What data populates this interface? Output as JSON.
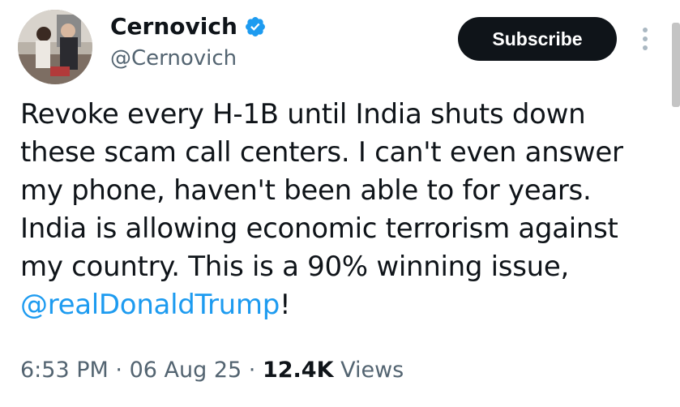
{
  "author": {
    "display_name": "Cernovich",
    "handle": "@Cernovich",
    "verified": true
  },
  "actions": {
    "subscribe_label": "Subscribe"
  },
  "tweet": {
    "lines": [
      "Revoke every H-1B until India shuts down",
      "these scam call centers. I can't even answer",
      "my phone, haven't been able to for years.",
      "India is allowing economic terrorism against",
      "my country. This is a 90% winning issue,"
    ],
    "mention": "@realDonaldTrump",
    "mention_suffix": "!"
  },
  "meta": {
    "time": "6:53 PM",
    "separator": "·",
    "date": "06 Aug 25",
    "views_count": "12.4K",
    "views_label": "Views"
  },
  "colors": {
    "accent": "#1d9bf0",
    "text": "#0f1419",
    "secondary": "#536471",
    "button_bg": "#0f1419"
  },
  "icons": {
    "verified": "verified-badge-icon",
    "more": "more-vertical-icon"
  }
}
